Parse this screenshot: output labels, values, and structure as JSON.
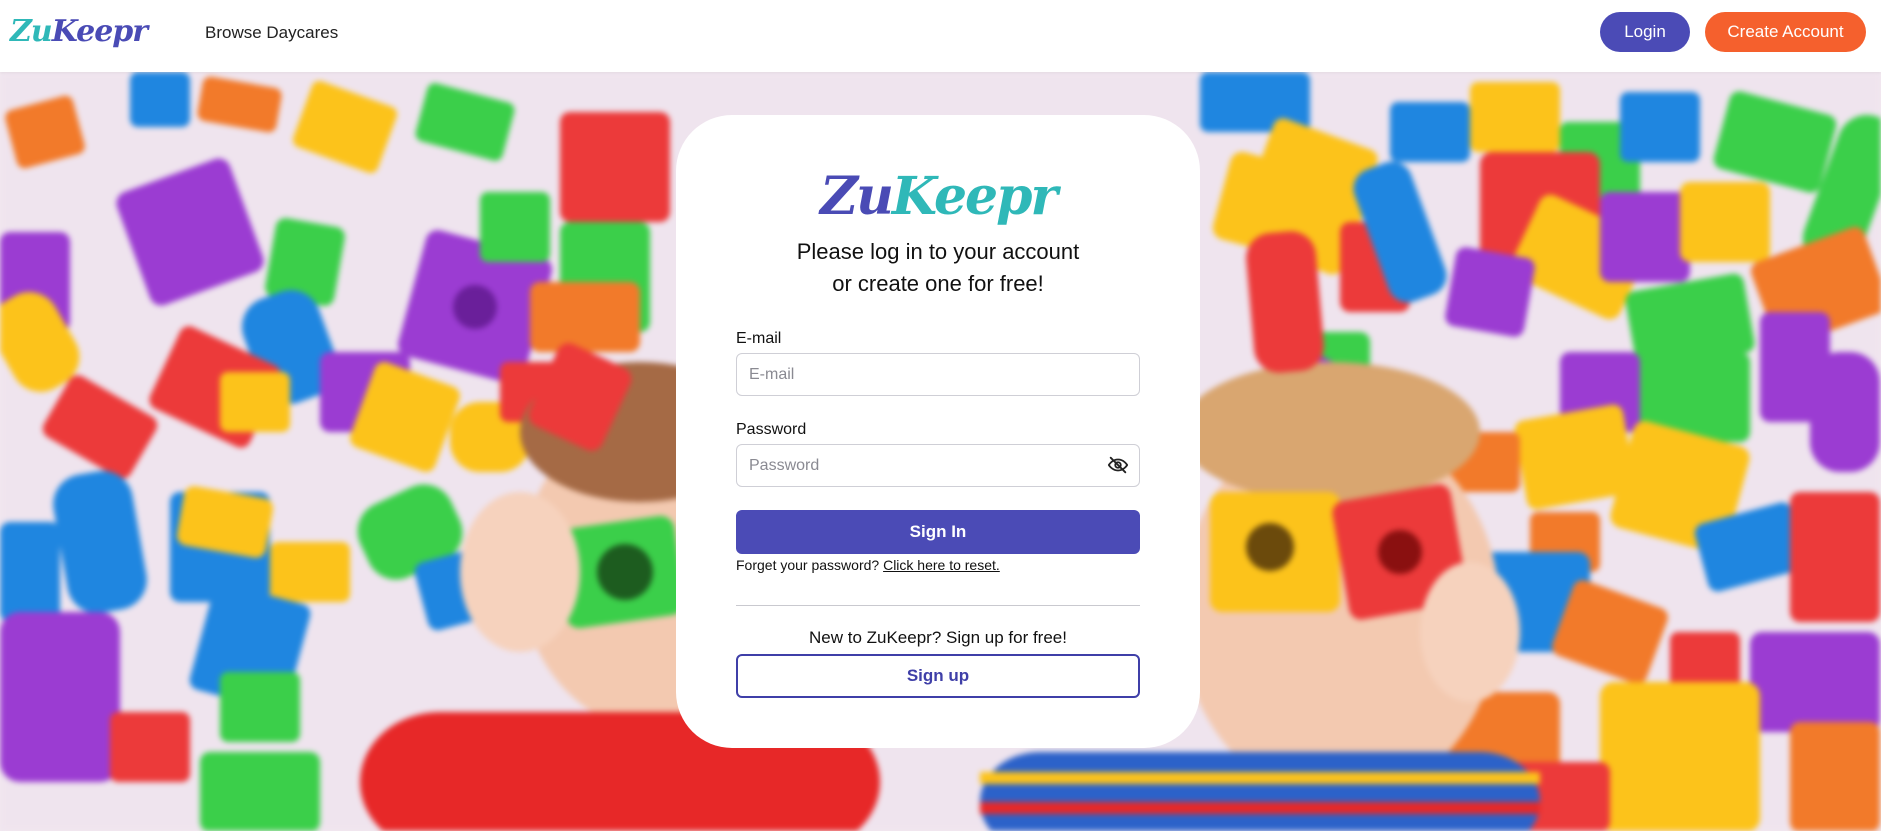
{
  "header": {
    "logo_part1": "Zu",
    "logo_part2": "Keepr",
    "nav_browse": "Browse Daycares",
    "login_label": "Login",
    "create_account_label": "Create Account"
  },
  "card": {
    "logo_part1": "Zu",
    "logo_part2": "Keepr",
    "subtitle_line1": "Please log in to your account",
    "subtitle_line2": "or create one for free!",
    "email_label": "E-mail",
    "email_placeholder": "E-mail",
    "email_value": "",
    "password_label": "Password",
    "password_placeholder": "Password",
    "password_value": "",
    "password_toggle_icon": "eye-slash-icon",
    "signin_label": "Sign In",
    "forgot_text": "Forget your password?",
    "forgot_link": "Click here to reset.",
    "new_text": "New to ZuKeepr? Sign up for free!",
    "signup_label": "Sign up"
  },
  "colors": {
    "brand_purple": "#4b4bb6",
    "brand_teal": "#2fb8b8",
    "brand_orange": "#f5602d"
  }
}
